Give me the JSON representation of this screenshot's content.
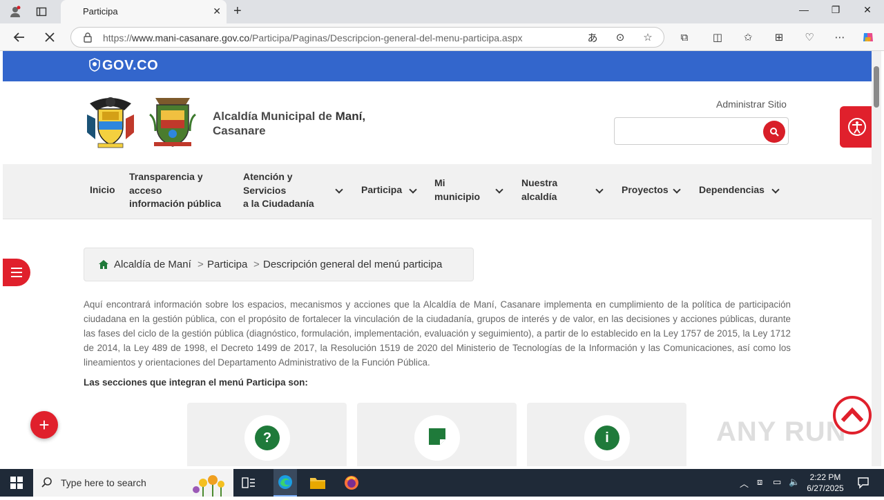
{
  "browser": {
    "tab_title": "Participa",
    "url_prefix": "https://",
    "url_host": "www.mani-casanare.gov.co",
    "url_path": "/Participa/Paginas/Descripcion-general-del-menu-participa.aspx"
  },
  "gov": {
    "label": "GOV.CO"
  },
  "header": {
    "title_line1_regular": "Alcaldía Municipal de ",
    "title_line1_bold": "Maní,",
    "title_line2": "Casanare",
    "admin_link": "Administrar Sitio",
    "search_placeholder": ""
  },
  "menu": {
    "inicio": "Inicio",
    "transparencia_1": "Transparencia y",
    "transparencia_2": "acceso",
    "transparencia_3": "información pública",
    "atencion_1": "Atención y",
    "atencion_2": "Servicios",
    "atencion_3": "a la Ciudadanía",
    "participa": "Participa",
    "municipio_1": "Mi",
    "municipio_2": "municipio",
    "alcaldia_1": "Nuestra",
    "alcaldia_2": "alcaldía",
    "proyectos": "Proyectos",
    "dependencias": "Dependencias"
  },
  "breadcrumb": {
    "home": "Alcaldía de Maní",
    "section": "Participa",
    "current": "Descripción general del menú participa",
    "sep": ">"
  },
  "content": {
    "intro": "Aquí encontrará información sobre los espacios, mecanismos y acciones que la Alcaldía de Maní, Casanare implementa en cumplimiento de la política de participación ciudadana en la gestión pública, con el propósito de fortalecer la vinculación de la ciudadanía, grupos de interés y de valor, en las decisiones y acciones públicas, durante las fases del ciclo de la gestión pública (diagnóstico, formulación, implementación, evaluación y seguimiento), a partir de lo establecido en la Ley 1757 de 2015, la Ley 1712 de 2014, la Ley 489 de 1998, el Decreto 1499 de 2017, la Resolución 1519 de 2020 del Ministerio de Tecnologías de la Información y las Comunicaciones, así como los lineamientos y orientaciones del Departamento Administrativo de la Función Pública.",
    "sections_label": "Las secciones que integran el menú Participa son:",
    "cards": [
      {
        "icon": "question-icon",
        "glyph": "?"
      },
      {
        "icon": "note-icon",
        "glyph": ""
      },
      {
        "icon": "info-icon",
        "glyph": "i"
      }
    ]
  },
  "watermark": "ANY RUN",
  "taskbar": {
    "search_placeholder": "Type here to search",
    "time": "2:22 PM",
    "date": "6/27/2025"
  },
  "colors": {
    "gov_blue": "#3366cc",
    "accent_red": "#e0202c",
    "icon_green": "#1f7a3a"
  }
}
